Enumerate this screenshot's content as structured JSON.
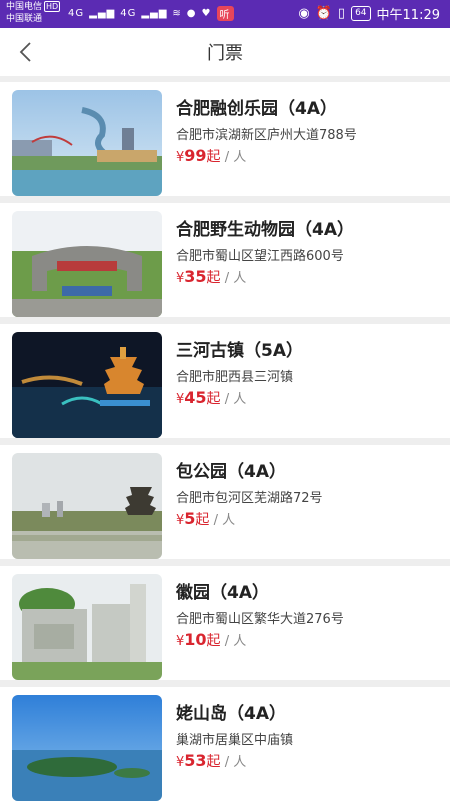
{
  "status_bar": {
    "carrier1": "中国电信",
    "hd": "HD",
    "carrier2": "中国联通",
    "net": "4G",
    "battery": "64",
    "time": "中午11:29",
    "notif": "听"
  },
  "header": {
    "title": "门票"
  },
  "currency": "¥",
  "tickets": [
    {
      "name": "合肥融创乐园（4A）",
      "address": "合肥市滨湖新区庐州大道788号",
      "price": "99",
      "price_suffix": "起",
      "unit": "/ 人",
      "image": "amusement-park"
    },
    {
      "name": "合肥野生动物园（4A）",
      "address": "合肥市蜀山区望江西路600号",
      "price": "35",
      "price_suffix": "起",
      "unit": "/ 人",
      "image": "zoo-gate"
    },
    {
      "name": "三河古镇（5A）",
      "address": "合肥市肥西县三河镇",
      "price": "45",
      "price_suffix": "起",
      "unit": "/ 人",
      "image": "night-pagoda"
    },
    {
      "name": "包公园（4A）",
      "address": "合肥市包河区芜湖路72号",
      "price": "5",
      "price_suffix": "起",
      "unit": "/ 人",
      "image": "lake-tower"
    },
    {
      "name": "徽园（4A）",
      "address": "合肥市蜀山区繁华大道276号",
      "price": "10",
      "price_suffix": "起",
      "unit": "/ 人",
      "image": "stone-gate"
    },
    {
      "name": "姥山岛（4A）",
      "address": "巢湖市居巢区中庙镇",
      "price": "53",
      "price_suffix": "起",
      "unit": "/ 人",
      "image": "island"
    }
  ]
}
